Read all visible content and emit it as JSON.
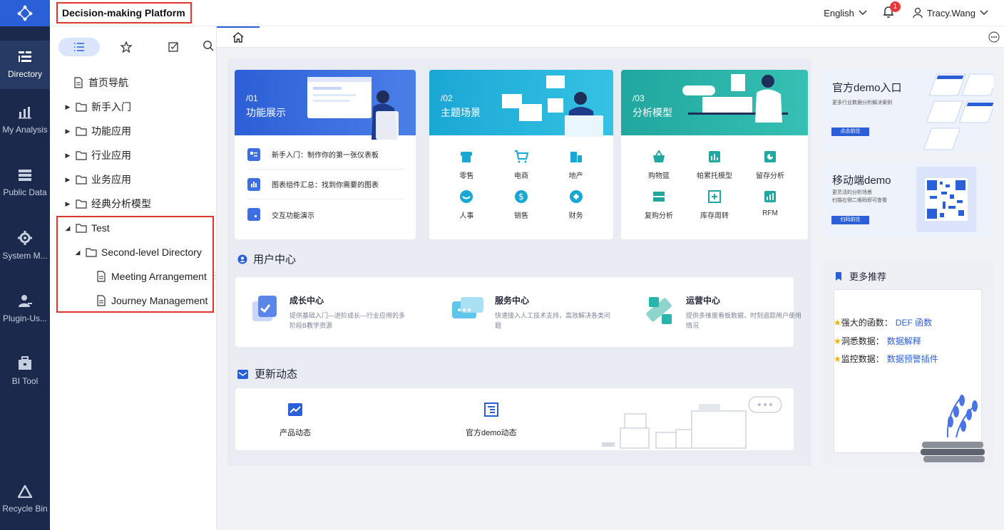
{
  "header": {
    "title": "Decision-making Platform",
    "language": "English",
    "notification_count": "1",
    "user": "Tracy.Wang"
  },
  "nav": {
    "items": [
      {
        "label": "Directory",
        "icon": "directory-icon"
      },
      {
        "label": "My Analysis",
        "icon": "bar-chart-icon"
      },
      {
        "label": "Public Data",
        "icon": "database-icon"
      },
      {
        "label": "System M...",
        "icon": "gear-icon"
      },
      {
        "label": "Plugin-Us...",
        "icon": "plugin-user-icon"
      },
      {
        "label": "BI Tool",
        "icon": "toolbox-icon"
      }
    ],
    "recycle": "Recycle Bin"
  },
  "tree": {
    "nodes": [
      {
        "label": "首页导航"
      },
      {
        "label": "新手入门"
      },
      {
        "label": "功能应用"
      },
      {
        "label": "行业应用"
      },
      {
        "label": "业务应用"
      },
      {
        "label": "经典分析模型"
      },
      {
        "label": "Test"
      },
      {
        "label": "Second-level Directory"
      },
      {
        "label": "Meeting Arrangement"
      },
      {
        "label": "Journey Management"
      }
    ]
  },
  "cards": {
    "c1": {
      "num": "/01",
      "title": "功能展示",
      "rows": [
        "新手入门：制作你的第一张仪表板",
        "图表组件汇总：找到你需要的图表",
        "交互功能演示"
      ]
    },
    "c2": {
      "num": "/02",
      "title": "主题场景",
      "items": [
        "零售",
        "电商",
        "地产",
        "人事",
        "销售",
        "财务"
      ]
    },
    "c3": {
      "num": "/03",
      "title": "分析模型",
      "items": [
        "购物篮",
        "帕累托模型",
        "留存分析",
        "复购分析",
        "库存周转",
        "RFM"
      ]
    }
  },
  "user_center": {
    "title": "用户中心",
    "items": [
      {
        "title": "成长中心",
        "desc": "提供基础入门—进阶成长—行业应用的多阶段B教学资源"
      },
      {
        "title": "服务中心",
        "desc": "快速接入人工技术支持，高效解决各类问题"
      },
      {
        "title": "运营中心",
        "desc": "提供多维度看板数据，时刻追踪用户使用情况"
      }
    ]
  },
  "news": {
    "title": "更新动态",
    "items": [
      "产品动态",
      "官方demo动态"
    ]
  },
  "right": {
    "demo1": {
      "title": "官方demo入口",
      "desc": "更多行业数据分析解决案例",
      "btn": "点击前往"
    },
    "demo2": {
      "title": "移动端demo",
      "desc1": "更灵活的分析场景",
      "desc2": "扫描右侧二维码即可查看",
      "btn": "扫码前往"
    },
    "more": {
      "title": "更多推荐",
      "lines": [
        {
          "label": "强大的函数：",
          "link": "DEF 函数"
        },
        {
          "label": "洞悉数据：",
          "link": "数据解释"
        },
        {
          "label": "监控数据：",
          "link": "数据预警插件"
        }
      ]
    }
  },
  "colors": {
    "accent": "#2a5fd8",
    "nav_bg": "#1b2a4c",
    "highlight_red": "#e0342f",
    "teal": "#27b5ae",
    "cyan": "#1fb1d8"
  }
}
